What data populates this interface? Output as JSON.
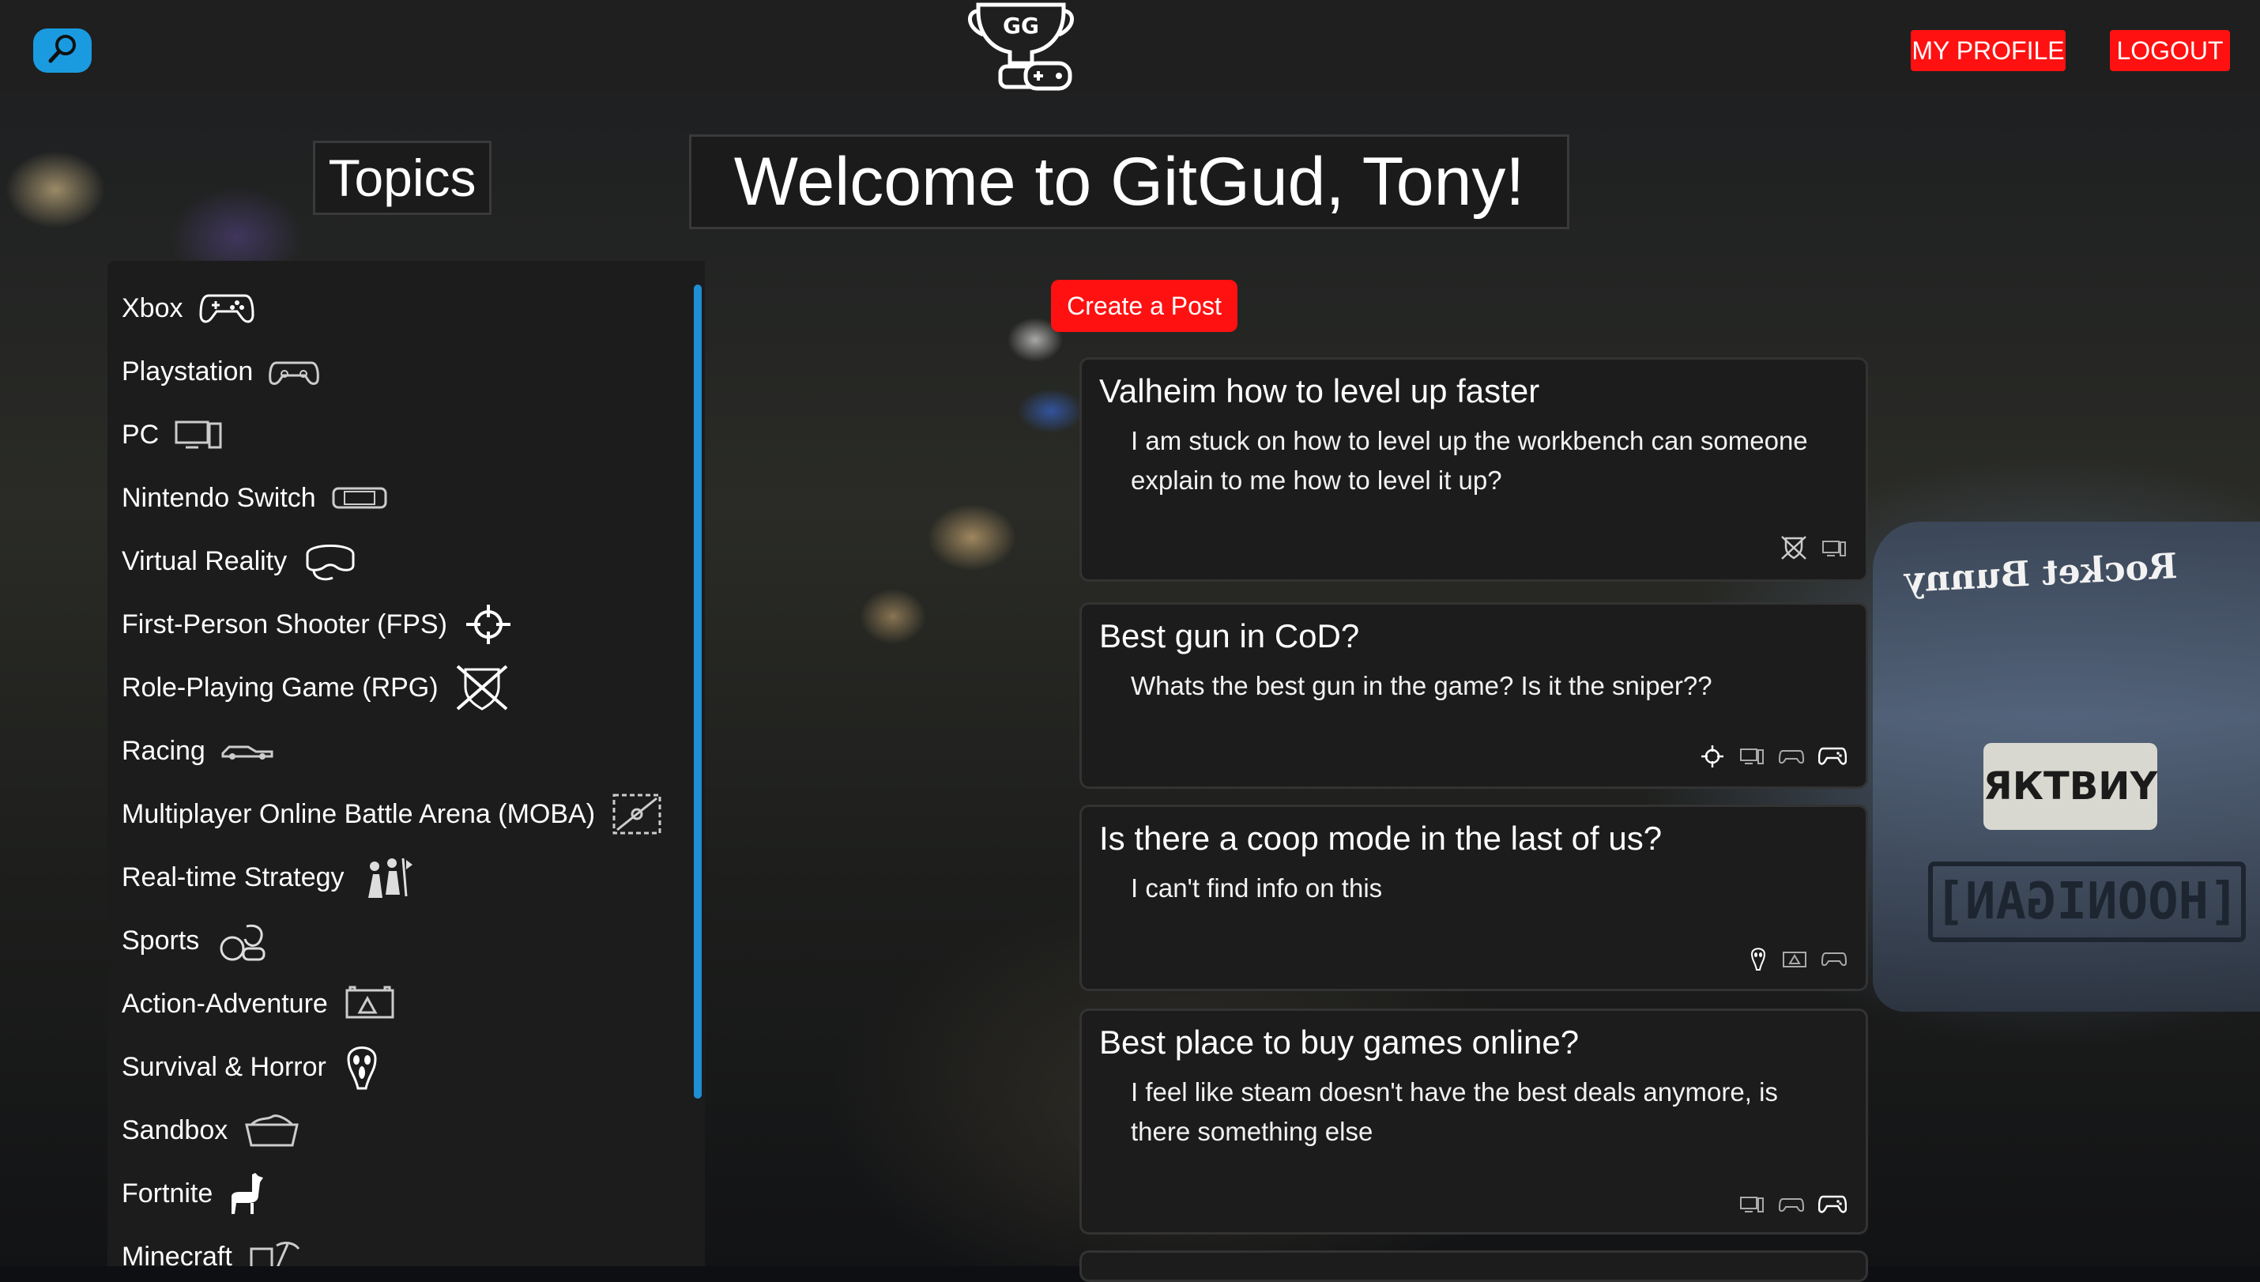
{
  "header": {
    "logo_text": "GG",
    "search_icon": "search-icon",
    "profile_label": "MY PROFILE",
    "logout_label": "LOGOUT"
  },
  "topics": {
    "title": "Topics",
    "items": [
      {
        "label": "Xbox",
        "icon": "xbox-controller-icon"
      },
      {
        "label": "Playstation",
        "icon": "playstation-controller-icon"
      },
      {
        "label": "PC",
        "icon": "pc-icon"
      },
      {
        "label": "Nintendo Switch",
        "icon": "switch-icon"
      },
      {
        "label": "Virtual Reality",
        "icon": "vr-headset-icon"
      },
      {
        "label": "First-Person Shooter (FPS)",
        "icon": "crosshair-icon"
      },
      {
        "label": "Role-Playing Game (RPG)",
        "icon": "shield-swords-icon"
      },
      {
        "label": "Racing",
        "icon": "race-car-icon"
      },
      {
        "label": "Multiplayer Online Battle Arena (MOBA)",
        "icon": "moba-map-icon"
      },
      {
        "label": "Real-time Strategy",
        "icon": "army-icon"
      },
      {
        "label": "Sports",
        "icon": "sports-icon"
      },
      {
        "label": "Action-Adventure",
        "icon": "action-adventure-icon"
      },
      {
        "label": "Survival & Horror",
        "icon": "ghost-mask-icon"
      },
      {
        "label": "Sandbox",
        "icon": "sandbox-icon"
      },
      {
        "label": "Fortnite",
        "icon": "llama-icon"
      },
      {
        "label": "Minecraft",
        "icon": "pickaxe-block-icon"
      }
    ]
  },
  "main": {
    "welcome": "Welcome to GitGud, Tony!",
    "create_label": "Create a Post",
    "posts": [
      {
        "title": "Valheim how to level up faster",
        "body": "I am stuck on how to level up the workbench can someone explain to me how to level it up?",
        "tags": [
          "shield-swords-icon",
          "pc-icon"
        ]
      },
      {
        "title": "Best gun in CoD?",
        "body": "Whats the best gun in the game? Is it the sniper??",
        "tags": [
          "crosshair-icon",
          "pc-icon",
          "playstation-controller-icon",
          "xbox-controller-icon"
        ]
      },
      {
        "title": "Is there a coop mode in the last of us?",
        "body": "I can't find info on this",
        "tags": [
          "ghost-mask-icon",
          "action-adventure-icon",
          "playstation-controller-icon"
        ]
      },
      {
        "title": "Best place to buy games online?",
        "body": "I feel like steam doesn't have the best deals anymore, is there something else",
        "tags": [
          "pc-icon",
          "playstation-controller-icon",
          "xbox-controller-icon"
        ]
      }
    ]
  },
  "background": {
    "sticker_text": "Rocket Bunny",
    "plate_text": "ЯКТВИY",
    "sign_text": "[HOONIGAN]"
  },
  "colors": {
    "accent_red": "#ff1111",
    "search_blue": "#1a9be0",
    "panel": "#1c1c1c"
  }
}
